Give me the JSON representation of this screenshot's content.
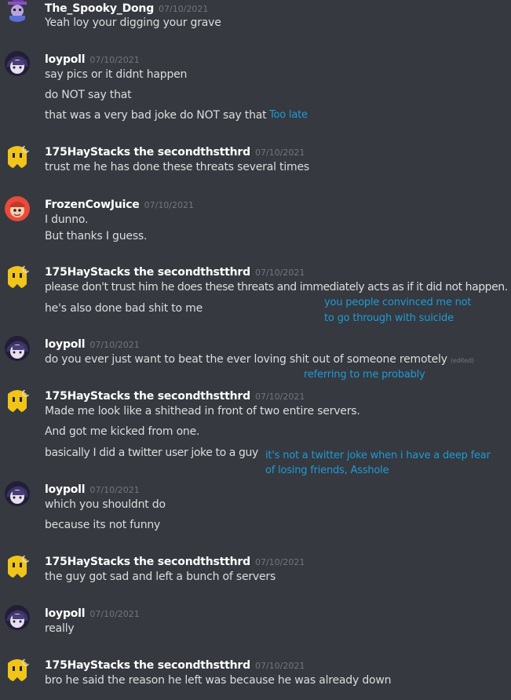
{
  "users": {
    "spooky": "The_Spooky_Dong",
    "loypoll": "loypoll",
    "hay": "175HayStacks the secondthstthrd",
    "frozen": "FrozenCowJuice"
  },
  "date": "07/10/2021",
  "edited_label": "(edited)",
  "messages": {
    "m1": [
      "Yeah loy your digging your grave"
    ],
    "m2": [
      "say pics or it didnt happen",
      "do NOT say that",
      "that was a very bad joke do NOT say that"
    ],
    "m3": [
      "trust me he has done these threats several times"
    ],
    "m4": [
      "I dunno.",
      "But thanks I guess."
    ],
    "m5": [
      "please don't trust him he does these threats and immediately acts as if it did not happen.",
      "he's also done bad shit to me"
    ],
    "m6": [
      "do you ever just want to beat the ever loving shit out of someone remotely"
    ],
    "m7": [
      "Made me look like a shithead in front of two entire servers.",
      "And got me kicked from one.",
      "basically I did a twitter user joke to a guy"
    ],
    "m8": [
      "which you shouldnt do",
      "because its not funny"
    ],
    "m9": [
      "the guy got sad and left a bunch of servers"
    ],
    "m10": [
      "really"
    ],
    "m11": [
      "bro he said the reason he left was because he was already down"
    ]
  },
  "annotations": {
    "too_late": "Too late",
    "convinced_1": "you people convinced me not",
    "convinced_2": "to go through with suicide",
    "referring": "referring to me probably",
    "twitter_1": "it's not a twitter joke when i have a deep fear",
    "twitter_2": "of losing friends, Asshole"
  },
  "colors": {
    "background": "#36393f",
    "username": "#ffffff",
    "timestamp": "#72767d",
    "text": "#dcddde",
    "annotation": "#1e9bd7"
  }
}
